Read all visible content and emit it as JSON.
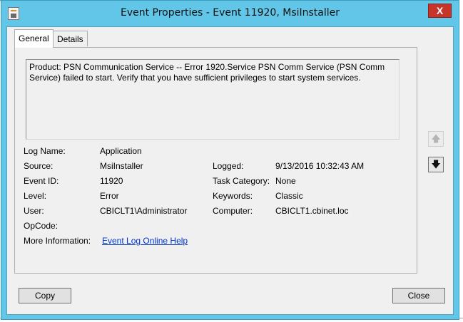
{
  "background": {
    "fragment_text": "ws"
  },
  "window": {
    "title": "Event Properties - Event 11920, MsiInstaller",
    "close_glyph": "X"
  },
  "tabs": [
    {
      "label": "General",
      "active": true
    },
    {
      "label": "Details",
      "active": false
    }
  ],
  "description": "Product: PSN Communication Service -- Error 1920.Service PSN Comm Service (PSN Comm Service) failed to start.  Verify that you have sufficient privileges to start system services.",
  "fields": {
    "log_name": {
      "label": "Log Name:",
      "value": "Application"
    },
    "source": {
      "label": "Source:",
      "value": "MsiInstaller"
    },
    "logged": {
      "label": "Logged:",
      "value": "9/13/2016 10:32:43 AM"
    },
    "event_id": {
      "label": "Event ID:",
      "value": "11920"
    },
    "task_category": {
      "label": "Task Category:",
      "value": "None"
    },
    "level": {
      "label": "Level:",
      "value": "Error"
    },
    "keywords": {
      "label": "Keywords:",
      "value": "Classic"
    },
    "user": {
      "label": "User:",
      "value": "CBICLT1\\Administrator"
    },
    "computer": {
      "label": "Computer:",
      "value": "CBICLT1.cbinet.loc"
    },
    "opcode": {
      "label": "OpCode:",
      "value": ""
    },
    "more_info": {
      "label": "More Information:",
      "link": "Event Log Online Help"
    }
  },
  "nav": {
    "up_icon": "arrow-up-icon",
    "down_icon": "arrow-down-icon",
    "up_enabled": false,
    "down_enabled": true
  },
  "buttons": {
    "copy": "Copy",
    "close": "Close"
  },
  "colors": {
    "title_bar": "#62c6e8",
    "close_button": "#c7342a",
    "link": "#0033cc"
  }
}
